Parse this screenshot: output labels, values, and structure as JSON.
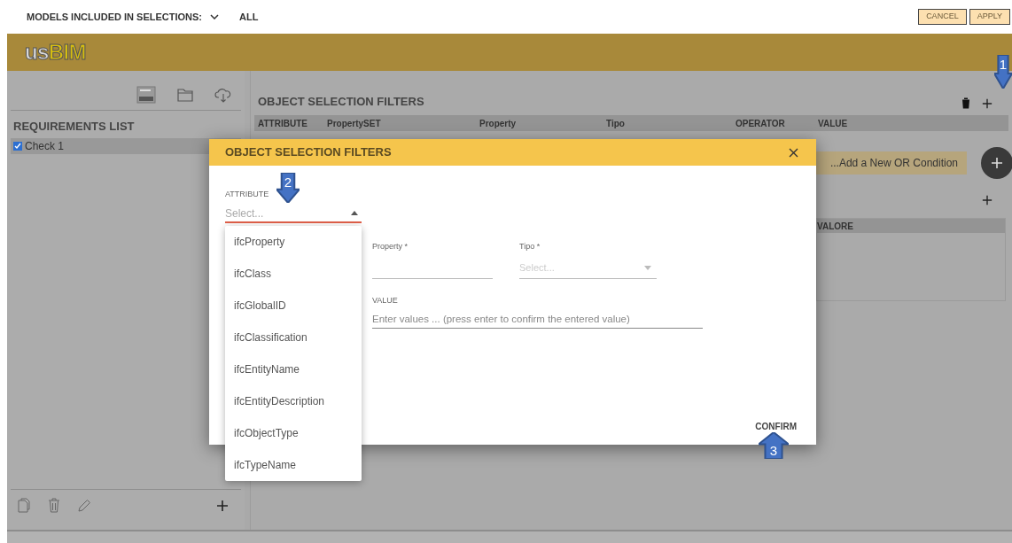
{
  "top_bar": {
    "models_label": "MODELS INCLUDED IN SELECTIONS:",
    "models_value": "ALL",
    "buttons": [
      "CANCEL",
      "APPLY"
    ]
  },
  "logo": {
    "light": "us",
    "bold": "BIM"
  },
  "sidebar": {
    "title": "REQUIREMENTS LIST",
    "items": [
      {
        "label": "Check 1",
        "checked": true,
        "selected": true
      }
    ]
  },
  "filters": {
    "title": "OBJECT SELECTION FILTERS",
    "columns": [
      "ATTRIBUTE",
      "PropertySET",
      "Property",
      "Tipo",
      "OPERATOR",
      "VALUE"
    ]
  },
  "or_condition": {
    "label": "...Add a New OR Condition"
  },
  "values_table": {
    "columns": [
      "VALORE"
    ]
  },
  "dialog": {
    "title": "OBJECT SELECTION FILTERS",
    "attribute": {
      "label": "ATTRIBUTE",
      "placeholder": "Select...",
      "expanded": true,
      "options": [
        "ifcProperty",
        "ifcClass",
        "ifcGlobalID",
        "ifcClassification",
        "ifcEntityName",
        "ifcEntityDescription",
        "ifcObjectType",
        "ifcTypeName"
      ]
    },
    "property": {
      "label": "Property *"
    },
    "tipo": {
      "label": "Tipo *",
      "placeholder": "Select..."
    },
    "value": {
      "label": "VALUE",
      "placeholder": "Enter values ... (press enter to confirm the entered value)"
    },
    "confirm": "CONFIRM"
  },
  "callouts": [
    {
      "number": "1",
      "kind": "down"
    },
    {
      "number": "2",
      "kind": "down"
    },
    {
      "number": "3",
      "kind": "up"
    }
  ]
}
